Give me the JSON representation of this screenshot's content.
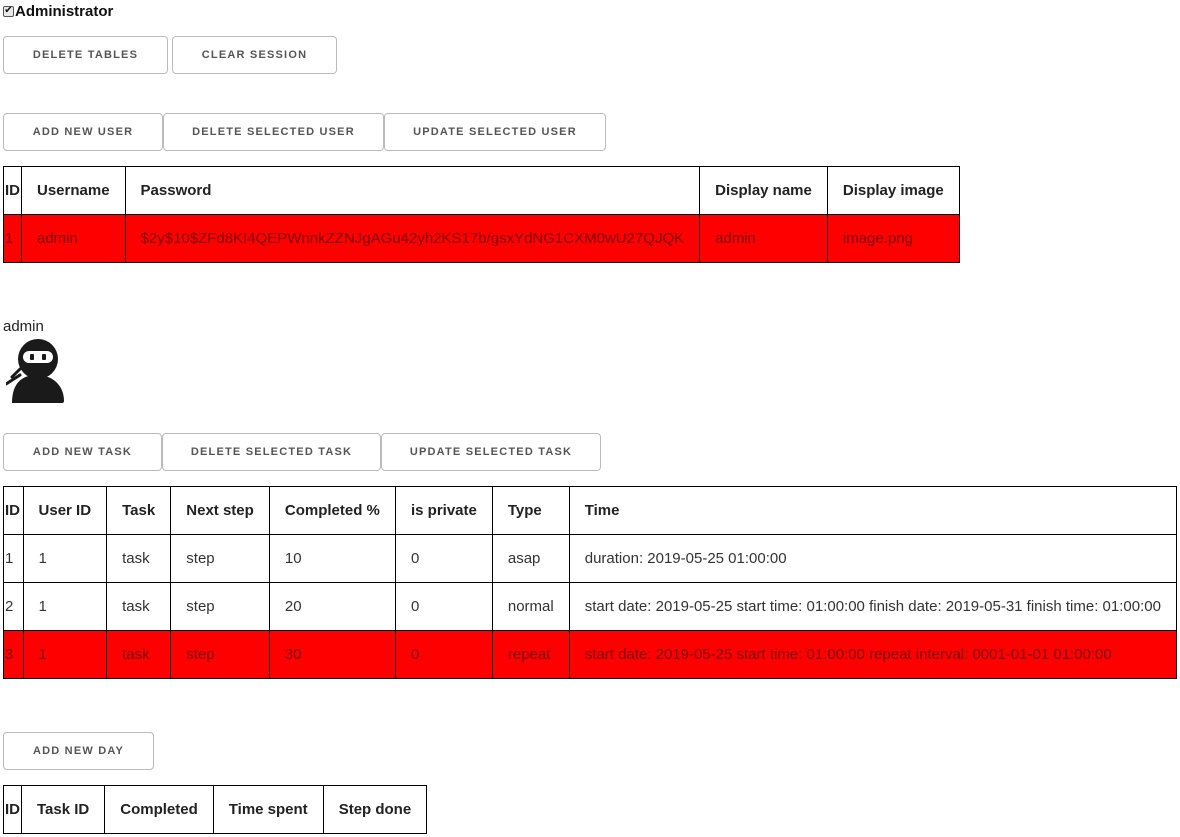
{
  "admin": {
    "checked": true,
    "label": "Administrator"
  },
  "session_buttons": {
    "delete_tables": "Delete tables",
    "clear_session": "Clear session"
  },
  "user_buttons": {
    "add": "Add new user",
    "delete": "Delete selected user",
    "update": "Update selected user"
  },
  "users_table": {
    "headers": [
      "ID",
      "Username",
      "Password",
      "Display name",
      "Display image"
    ],
    "rows": [
      [
        "1",
        "admin",
        "$2y$10$ZFd8KI4QEPWnnkZZNJgAGu42yh2KS17b/gsxYdNG1CXM0wU27QJQK",
        "admin",
        "image.png"
      ]
    ],
    "selected_row": 0
  },
  "profile": {
    "display_name": "admin",
    "avatar_icon": "ninja-avatar-icon"
  },
  "task_buttons": {
    "add": "Add new task",
    "delete": "Delete selected task",
    "update": "Update selected task"
  },
  "tasks_table": {
    "headers": [
      "ID",
      "User ID",
      "Task",
      "Next step",
      "Completed %",
      "is private",
      "Type",
      "Time"
    ],
    "rows": [
      [
        "1",
        "1",
        "task",
        "step",
        "10",
        "0",
        "asap",
        "duration: 2019-05-25 01:00:00"
      ],
      [
        "2",
        "1",
        "task",
        "step",
        "20",
        "0",
        "normal",
        "start date: 2019-05-25 start time: 01:00:00 finish date: 2019-05-31 finish time: 01:00:00"
      ],
      [
        "3",
        "1",
        "task",
        "step",
        "30",
        "0",
        "repeat",
        "start date: 2019-05-25 start time: 01:00:00 repeat interval: 0001-01-01 01:00:00"
      ]
    ],
    "selected_row": 2
  },
  "day_buttons": {
    "add": "Add new day"
  },
  "days_table": {
    "headers": [
      "ID",
      "Task ID",
      "Completed",
      "Time spent",
      "Step done"
    ],
    "rows": []
  },
  "colors": {
    "selected_row": "#ff0000",
    "border": "#000000",
    "button_border": "#bbbbbb"
  }
}
